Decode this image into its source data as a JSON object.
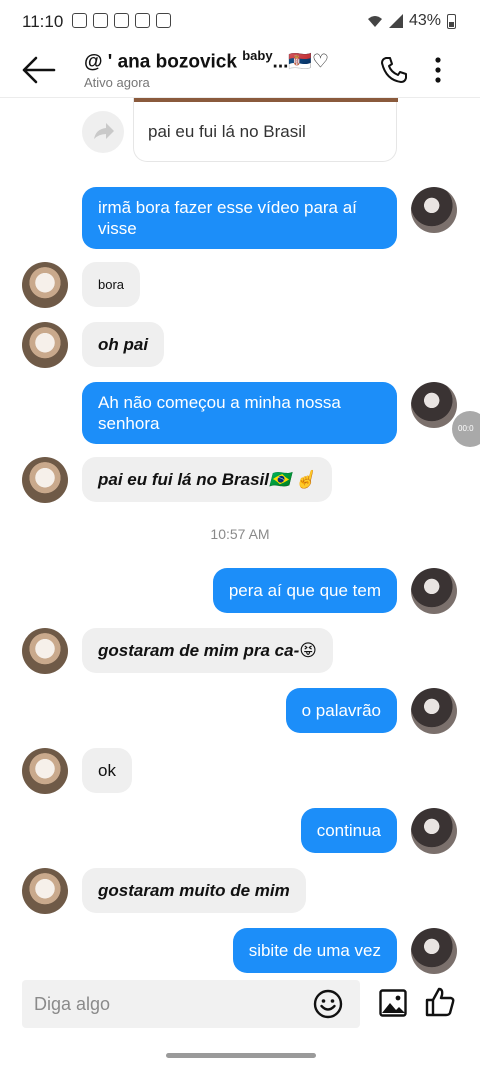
{
  "status": {
    "time": "11:10",
    "battery": "43%"
  },
  "header": {
    "title": "@ ' ana bozovick",
    "title_sup": "baby",
    "title_tail": "...🇷🇸♡",
    "subtitle": "Ativo agora"
  },
  "shared": {
    "text": "pai eu fui lá no Brasil"
  },
  "messages": [
    {
      "side": "out",
      "text": "irmã bora fazer esse vídeo para aí visse"
    },
    {
      "side": "in",
      "text": "bora"
    },
    {
      "side": "in",
      "text": "oh pai"
    },
    {
      "side": "out",
      "text": "Ah não começou a minha nossa senhora"
    },
    {
      "side": "in",
      "text": "pai eu fui lá no Brasil🇧🇷 ☝️"
    },
    {
      "side": "out",
      "text": "pera aí que que tem"
    },
    {
      "side": "in",
      "text": "gostaram de mim pra ca-😝"
    },
    {
      "side": "out",
      "text": "o palavrão"
    },
    {
      "side": "in",
      "text": "ok"
    },
    {
      "side": "out",
      "text": "continua"
    },
    {
      "side": "in",
      "text": "gostaram muito de mim"
    },
    {
      "side": "out",
      "text": "sibite de uma vez"
    }
  ],
  "timestamp": "10:57 AM",
  "float_chip": "00:0",
  "composer": {
    "placeholder": "Diga algo"
  },
  "icons": {
    "back": "back-arrow-icon",
    "phone": "phone-icon",
    "more": "more-vertical-icon",
    "share": "share-arrow-icon",
    "emoji": "emoji-icon",
    "image": "image-icon",
    "like": "thumbs-up-icon"
  },
  "colors": {
    "outgoing_bubble": "#1c8ef9",
    "incoming_bubble": "#efefef"
  }
}
